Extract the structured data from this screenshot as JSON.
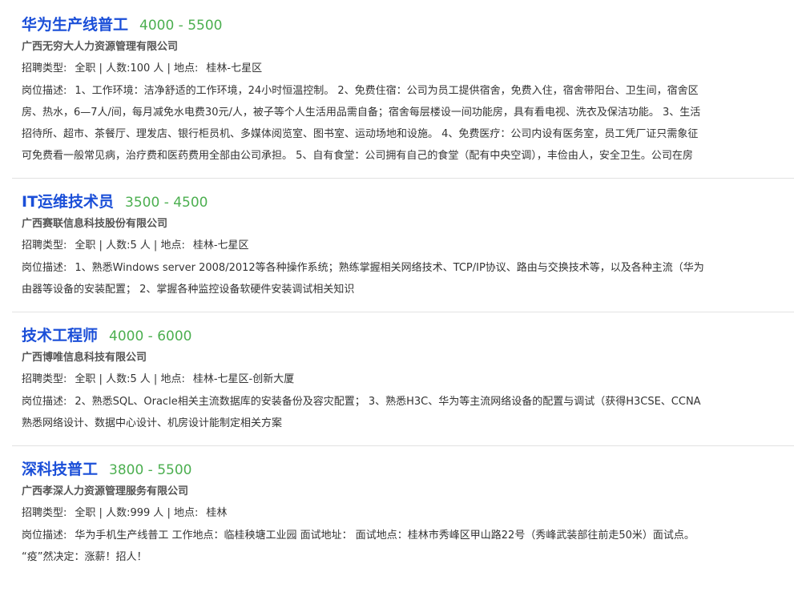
{
  "labels": {
    "type": "招聘类型:",
    "count": "人数:",
    "location": "地点:",
    "desc": "岗位描述:",
    "sep": "|",
    "unit": "人"
  },
  "jobs": [
    {
      "title": "华为生产线普工",
      "salary": "4000 - 5500",
      "company": "广西无穷大人力资源管理有限公司",
      "type": "全职",
      "count": "100",
      "location": "桂林-七星区",
      "desc_lines": [
        "1、工作环境：洁净舒适的工作环境，24小时恒温控制。 2、免费住宿：公司为员工提供宿舍，免费入住，宿舍带阳台、卫生间，宿舍区",
        "房、热水，6—7人/间，每月减免水电费30元/人，被子等个人生活用品需自备；宿舍每层楼设一间功能房，具有看电视、洗衣及保洁功能。 3、生活",
        "招待所、超市、茶餐厅、理发店、银行柜员机、多媒体阅览室、图书室、运动场地和设施。 4、免费医疗：公司内设有医务室，员工凭厂证只需象征",
        "可免费看一般常见病，治疗费和医药费用全部由公司承担。 5、自有食堂：公司拥有自己的食堂（配有中央空调），丰俭由人，安全卫生。公司在房"
      ]
    },
    {
      "title": "IT运维技术员",
      "salary": "3500 - 4500",
      "company": "广西赛联信息科技股份有限公司",
      "type": "全职",
      "count": "5",
      "location": "桂林-七星区",
      "desc_lines": [
        "1、熟悉Windows server 2008/2012等各种操作系统；熟练掌握相关网络技术、TCP/IP协议、路由与交换技术等，以及各种主流（华为",
        "由器等设备的安装配置； 2、掌握各种监控设备软硬件安装调试相关知识"
      ]
    },
    {
      "title": "技术工程师",
      "salary": "4000 - 6000",
      "company": "广西博唯信息科技有限公司",
      "type": "全职",
      "count": "5",
      "location": "桂林-七星区-创新大厦",
      "desc_lines": [
        "2、熟悉SQL、Oracle相关主流数据库的安装备份及容灾配置； 3、熟悉H3C、华为等主流网络设备的配置与调试（获得H3CSE、CCNA",
        "熟悉网络设计、数据中心设计、机房设计能制定相关方案"
      ]
    },
    {
      "title": "深科技普工",
      "salary": "3800 - 5500",
      "company": "广西孝深人力资源管理服务有限公司",
      "type": "全职",
      "count": "999",
      "location": "桂林",
      "desc_lines": [
        "华为手机生产线普工 工作地点：临桂秧塘工业园 面试地址： 面试地点：桂林市秀峰区甲山路22号（秀峰武装部往前走50米）面试点。",
        "“疫”然决定：涨薪！招人！"
      ]
    }
  ]
}
